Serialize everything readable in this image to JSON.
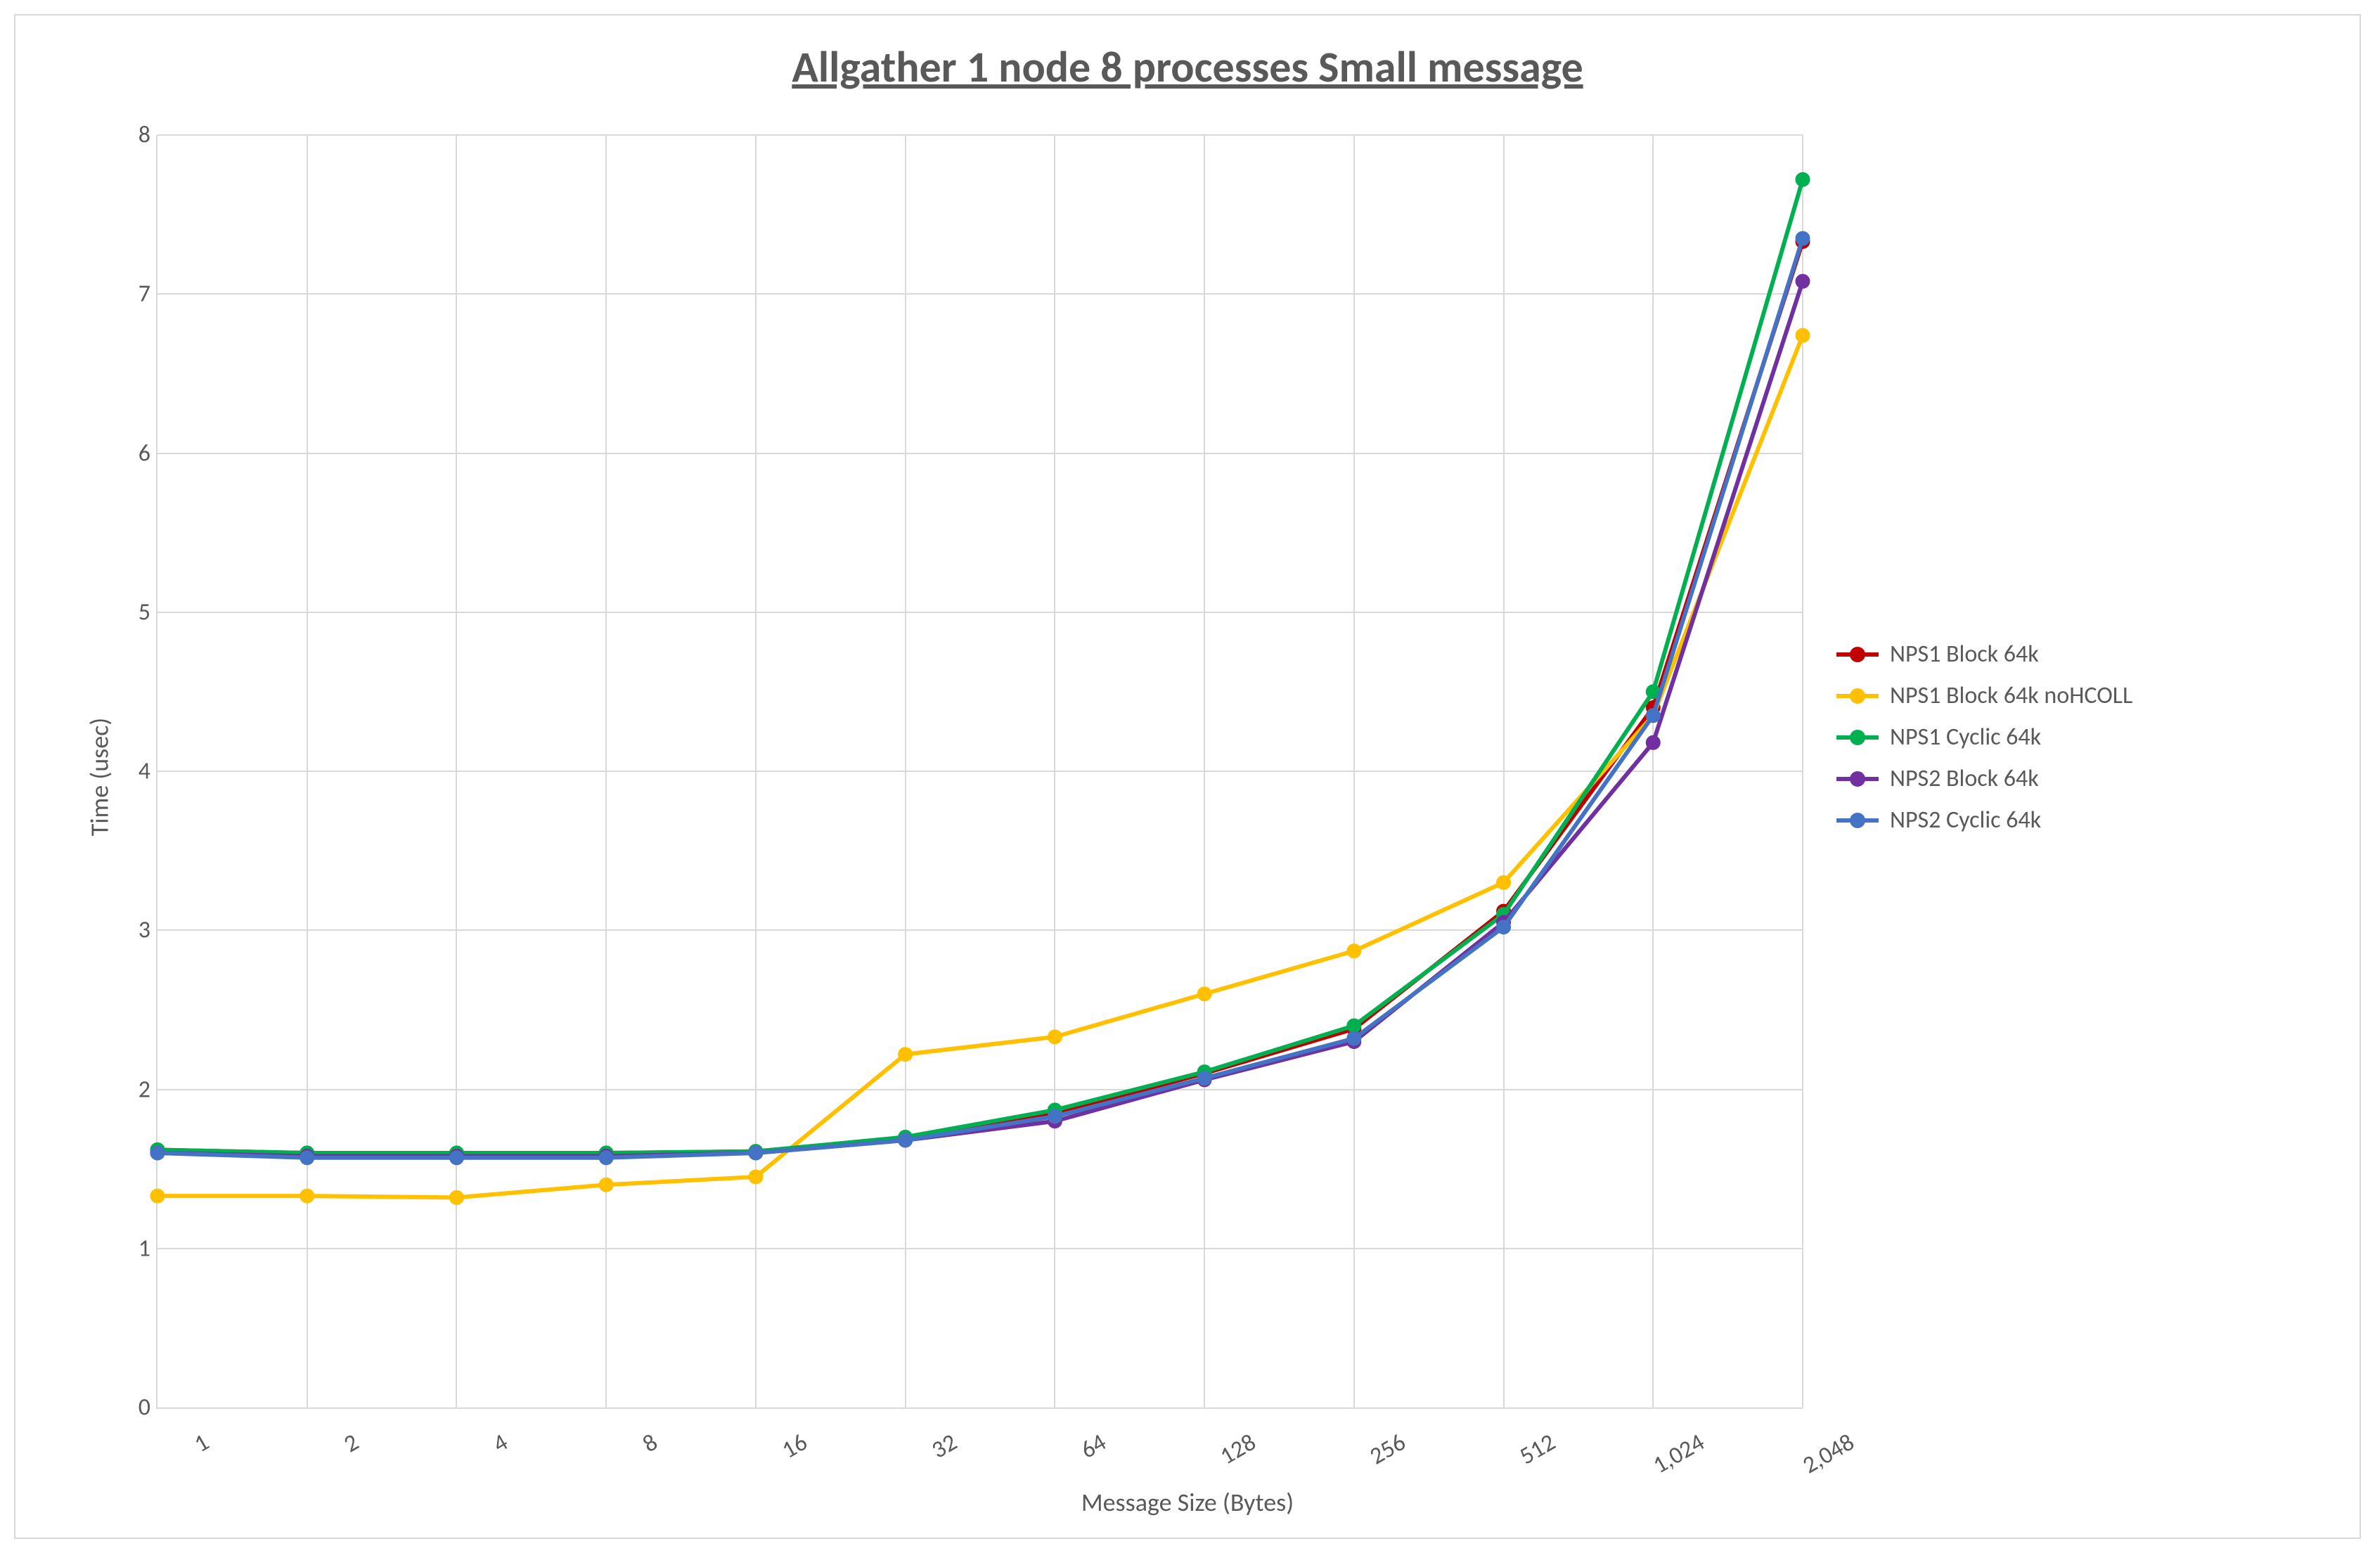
{
  "chart_data": {
    "type": "line",
    "title": "Allgather 1 node 8 processes Small message",
    "xlabel": "Message Size (Bytes)",
    "ylabel": "Time (usec)",
    "ylim": [
      0,
      8
    ],
    "yticks": [
      0,
      1,
      2,
      3,
      4,
      5,
      6,
      7,
      8
    ],
    "categories": [
      1,
      2,
      4,
      8,
      16,
      32,
      64,
      128,
      256,
      512,
      1024,
      2048
    ],
    "xticklabels": [
      "1",
      "2",
      "4",
      "8",
      "16",
      "32",
      "64",
      "128",
      "256",
      "512",
      "1,024",
      "2,048"
    ],
    "series": [
      {
        "name": "NPS1 Block 64k",
        "color": "#C00000",
        "values": [
          1.62,
          1.6,
          1.6,
          1.6,
          1.61,
          1.69,
          1.85,
          2.1,
          2.38,
          3.12,
          4.4,
          7.33
        ]
      },
      {
        "name": "NPS1 Block 64k noHCOLL",
        "color": "#FFC000",
        "values": [
          1.33,
          1.33,
          1.32,
          1.4,
          1.45,
          2.22,
          2.33,
          2.6,
          2.87,
          3.3,
          4.35,
          6.74
        ]
      },
      {
        "name": "NPS1 Cyclic 64k",
        "color": "#00B050",
        "values": [
          1.62,
          1.6,
          1.6,
          1.6,
          1.61,
          1.7,
          1.87,
          2.11,
          2.4,
          3.1,
          4.5,
          7.72
        ]
      },
      {
        "name": "NPS2 Block 64k",
        "color": "#7030A0",
        "values": [
          1.6,
          1.58,
          1.58,
          1.58,
          1.6,
          1.68,
          1.8,
          2.06,
          2.3,
          3.05,
          4.18,
          7.08
        ]
      },
      {
        "name": "NPS2 Cyclic 64k",
        "color": "#4472C4",
        "values": [
          1.6,
          1.57,
          1.57,
          1.57,
          1.6,
          1.68,
          1.83,
          2.07,
          2.32,
          3.02,
          4.35,
          7.35
        ]
      }
    ]
  }
}
